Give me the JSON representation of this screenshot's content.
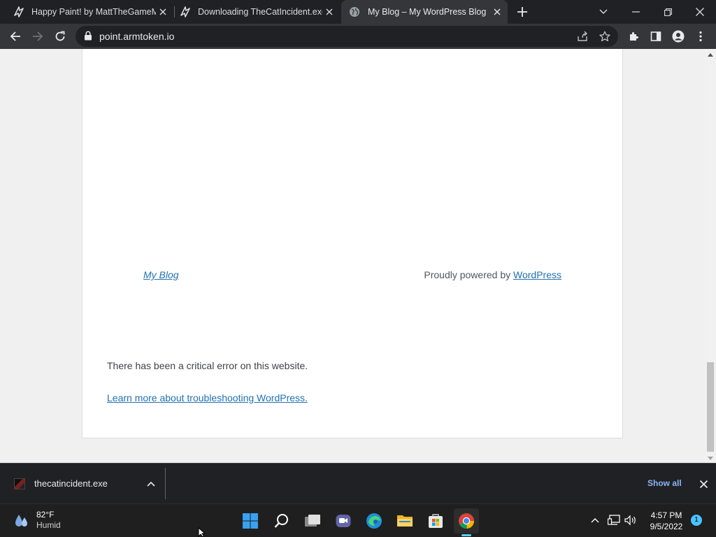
{
  "browser": {
    "tabs": [
      {
        "title": "Happy Paint! by MattTheGameMaker",
        "favicon": "itch-icon",
        "active": false
      },
      {
        "title": "Downloading TheCatIncident.exe",
        "favicon": "itch-icon",
        "active": false
      },
      {
        "title": "My Blog – My WordPress Blog",
        "favicon": "globe-icon",
        "active": true
      }
    ],
    "url": "point.armtoken.io"
  },
  "page": {
    "footer_site_link": "My Blog",
    "footer_powered_prefix": "Proudly powered by",
    "footer_powered_link": "WordPress",
    "error_message": "There has been a critical error on this website.",
    "error_link": "Learn more about troubleshooting WordPress."
  },
  "download_shelf": {
    "file_name": "thecatincident.exe",
    "show_all_label": "Show all"
  },
  "taskbar": {
    "weather_temp": "82°F",
    "weather_condition": "Humid",
    "time": "4:57 PM",
    "date": "9/5/2022",
    "notification_count": "1"
  },
  "colors": {
    "tab_strip": "#202124",
    "toolbar": "#35363a",
    "link": "#2271b1",
    "accent": "#8ab4f8"
  }
}
